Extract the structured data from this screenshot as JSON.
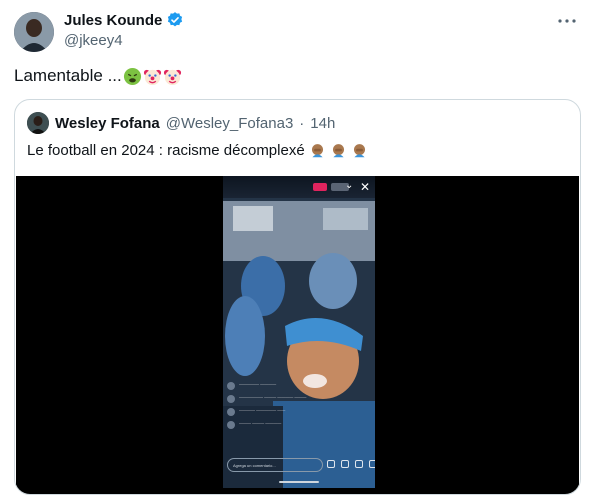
{
  "author": {
    "name": "Jules Kounde",
    "handle": "@jkeey4",
    "verified_icon": "verified-badge-icon"
  },
  "tweet": {
    "text": "Lamentable ...",
    "emojis": [
      "nauseated-face",
      "clown-face",
      "clown-face"
    ]
  },
  "quote": {
    "name": "Wesley Fofana",
    "handle": "@Wesley_Fofana3",
    "separator": "·",
    "time": "14h",
    "text": "Le football en 2024 : racisme décomplexé",
    "emojis": [
      "facepalm",
      "facepalm",
      "facepalm"
    ]
  },
  "media": {
    "comment_placeholder": "Agrega un comentario..."
  },
  "colors": {
    "verified": "#1d9bf0",
    "text": "#0f1419",
    "muted": "#536471",
    "border": "#cfd9de"
  }
}
